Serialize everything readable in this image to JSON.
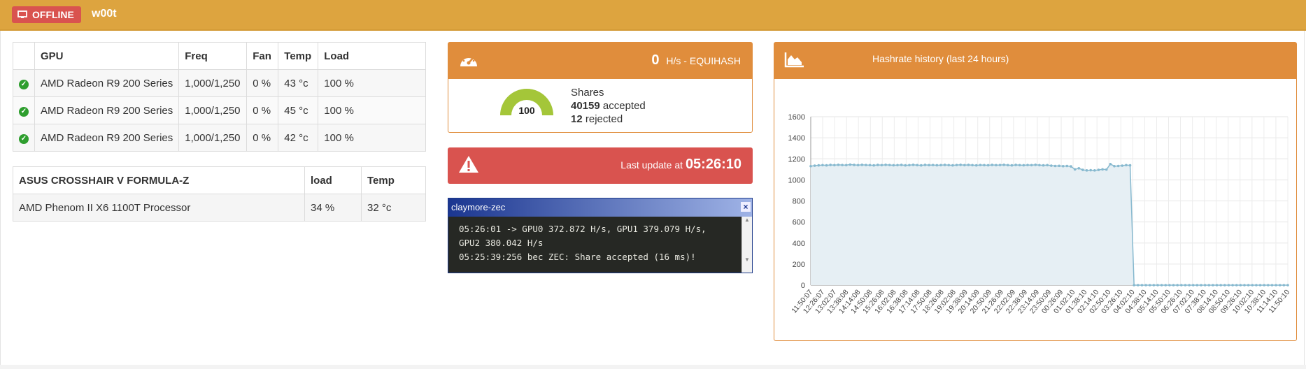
{
  "header": {
    "status": "OFFLINE",
    "rig_name": "w00t"
  },
  "gpu_table": {
    "headers": [
      "GPU",
      "Freq",
      "Fan",
      "Temp",
      "Load"
    ],
    "rows": [
      {
        "gpu": "AMD Radeon R9 200 Series",
        "freq": "1,000/1,250",
        "fan": "0 %",
        "temp": "43 °c",
        "load": "100 %"
      },
      {
        "gpu": "AMD Radeon R9 200 Series",
        "freq": "1,000/1,250",
        "fan": "0 %",
        "temp": "45 °c",
        "load": "100 %"
      },
      {
        "gpu": "AMD Radeon R9 200 Series",
        "freq": "1,000/1,250",
        "fan": "0 %",
        "temp": "42 °c",
        "load": "100 %"
      }
    ]
  },
  "mb_table": {
    "headers": [
      "ASUS CROSSHAIR V FORMULA-Z",
      "load",
      "Temp"
    ],
    "rows": [
      {
        "name": "AMD Phenom II X6 1100T Processor",
        "load": "34 %",
        "temp": "32 °c"
      }
    ]
  },
  "hashrate": {
    "value": "0",
    "unit": "H/s - EQUIHASH",
    "gauge_value": "100",
    "gauge_fraction": 1.0,
    "shares_label": "Shares",
    "accepted_count": "40159",
    "accepted_label": "accepted",
    "rejected_count": "12",
    "rejected_label": "rejected"
  },
  "last_update": {
    "label": "Last update at",
    "time": "05:26:10"
  },
  "console": {
    "title": "claymore-zec",
    "close": "×",
    "lines": [
      "05:26:01 -> GPU0 372.872 H/s, GPU1 379.079 H/s,",
      "GPU2 380.042 H/s",
      "05:25:39:256 bec ZEC: Share accepted (16 ms)!"
    ]
  },
  "chart_data": {
    "type": "area",
    "title": "Hashrate history (last 24 hours)",
    "ylim": [
      0,
      1600
    ],
    "yticks": [
      0,
      200,
      400,
      600,
      800,
      1000,
      1200,
      1400,
      1600
    ],
    "grid": true,
    "x_ticks": [
      "11:50:07",
      "12:26:07",
      "13:02:07",
      "13:38:08",
      "14:14:08",
      "14:50:08",
      "15:26:08",
      "16:02:08",
      "16:38:08",
      "17:14:08",
      "17:50:08",
      "18:26:08",
      "19:02:08",
      "19:38:09",
      "20:14:09",
      "20:50:09",
      "21:26:09",
      "22:02:09",
      "22:38:09",
      "23:14:09",
      "23:50:09",
      "00:26:09",
      "01:02:10",
      "01:38:10",
      "02:14:10",
      "02:50:10",
      "03:26:10",
      "04:02:10",
      "04:38:10",
      "05:14:10",
      "05:50:10",
      "06:26:10",
      "07:02:10",
      "07:38:10",
      "08:14:10",
      "08:50:10",
      "09:26:10",
      "10:02:10",
      "10:38:10",
      "11:14:10",
      "11:50:10"
    ],
    "values": [
      1130,
      1135,
      1138,
      1140,
      1138,
      1142,
      1140,
      1143,
      1141,
      1140,
      1145,
      1142,
      1140,
      1143,
      1141,
      1140,
      1138,
      1142,
      1140,
      1143,
      1141,
      1139,
      1140,
      1142,
      1138,
      1140,
      1143,
      1140,
      1138,
      1142,
      1140,
      1141,
      1139,
      1140,
      1142,
      1140,
      1138,
      1141,
      1143,
      1140,
      1142,
      1140,
      1138,
      1141,
      1140,
      1139,
      1142,
      1140,
      1141,
      1143,
      1140,
      1138,
      1142,
      1140,
      1139,
      1141,
      1140,
      1143,
      1140,
      1138,
      1140,
      1135,
      1132,
      1133,
      1130,
      1132,
      1128,
      1100,
      1110,
      1095,
      1090,
      1092,
      1090,
      1095,
      1100,
      1098,
      1150,
      1130,
      1132,
      1135,
      1140,
      1138,
      0,
      0,
      0,
      0,
      0,
      0,
      0,
      0,
      0,
      0,
      0,
      0,
      0,
      0,
      0,
      0,
      0,
      0,
      0,
      0,
      0,
      0,
      0,
      0,
      0,
      0,
      0,
      0,
      0,
      0,
      0,
      0,
      0,
      0,
      0,
      0,
      0,
      0,
      0,
      0
    ]
  },
  "colors": {
    "topbar": "#dda43f",
    "panel_orange": "#e08d3c",
    "danger": "#d9534f",
    "gauge": "#a4c639",
    "series": "#87b9cf"
  }
}
